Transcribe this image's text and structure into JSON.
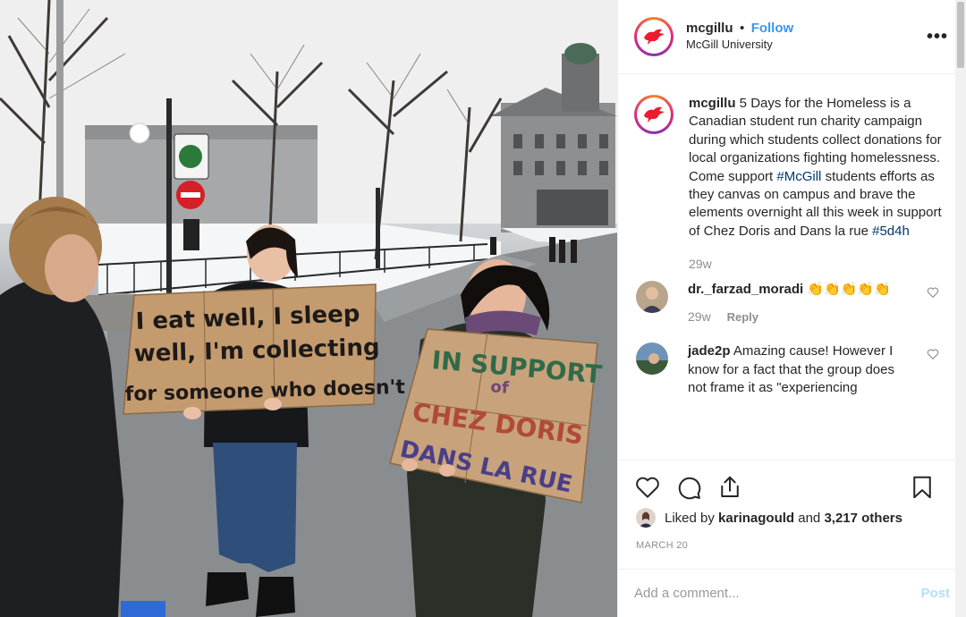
{
  "photo": {
    "alt_signs": {
      "left_sign": [
        "I eat well, I sleep",
        "well, I'm collecting",
        "for someone who doesn't"
      ],
      "right_sign": [
        "IN SUPPORT",
        "of",
        "CHEZ DORIS",
        "DANS LA RUE"
      ]
    }
  },
  "post": {
    "username": "mcgillu",
    "dot": "•",
    "follow_label": "Follow",
    "subtitle": "McGill University",
    "more_label": "•••",
    "caption": {
      "username": "mcgillu",
      "text_before_tag": " 5 Days for the Homeless is a Canadian student run charity campaign during which students collect donations for local organizations fighting homelessness. Come support ",
      "tag1": "#McGill",
      "text_after_tag": " students efforts as they canvas on campus and brave the elements overnight all this week in support of Chez Doris and Dans la rue ",
      "tag2": "#5d4h",
      "time": "29w"
    },
    "comments": [
      {
        "username": "dr._farzad_moradi",
        "text": " 👏👏👏👏👏",
        "time": "29w",
        "reply_label": "Reply"
      },
      {
        "username": "jade2p",
        "text": " Amazing cause! However I know for a fact that the group does not frame it as \"experiencing"
      }
    ],
    "likes": {
      "prefix": "Liked by ",
      "user": "karinagould",
      "middle": " and ",
      "count": "3,217 others"
    },
    "date": "MARCH 20",
    "comment_placeholder": "Add a comment...",
    "post_label": "Post"
  },
  "colors": {
    "link_blue": "#3897f0",
    "tag_blue": "#00376b",
    "muted": "#8e8e8e",
    "post_disabled": "#b2dffc",
    "brand_red": "#ed1b2f"
  },
  "icons": [
    "heart-icon",
    "comment-icon",
    "share-icon",
    "bookmark-icon",
    "more-icon",
    "mcgill-logo"
  ]
}
